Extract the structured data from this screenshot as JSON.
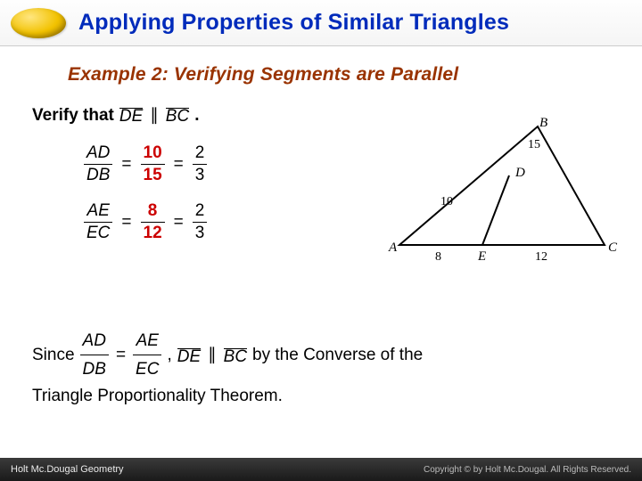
{
  "header": {
    "title": "Applying Properties of Similar Triangles"
  },
  "subtitle": "Example 2: Verifying Segments are Parallel",
  "verify": {
    "prefix": "Verify that",
    "seg1": "DE",
    "seg2": "BC",
    "suffix": "."
  },
  "eq1": {
    "n1": "AD",
    "d1": "DB",
    "n2": "10",
    "d2": "15",
    "n3": "2",
    "d3": "3"
  },
  "eq2": {
    "n1": "AE",
    "d1": "EC",
    "n2": "8",
    "d2": "12",
    "n3": "2",
    "d3": "3"
  },
  "conc": {
    "since": "Since",
    "n1": "AD",
    "d1": "DB",
    "n2": "AE",
    "d2": "EC",
    "comma": ",",
    "seg1": "DE",
    "seg2": "BC",
    "tail1": "by the Converse of the",
    "tail2": "Triangle Proportionality Theorem."
  },
  "diagram": {
    "A": "A",
    "B": "B",
    "C": "C",
    "D": "D",
    "E": "E",
    "AE": "8",
    "EC": "12",
    "AD": "10",
    "DB": "15"
  },
  "footer": {
    "left": "Holt Mc.Dougal Geometry",
    "right": "Copyright © by Holt Mc.Dougal. All Rights Reserved."
  }
}
